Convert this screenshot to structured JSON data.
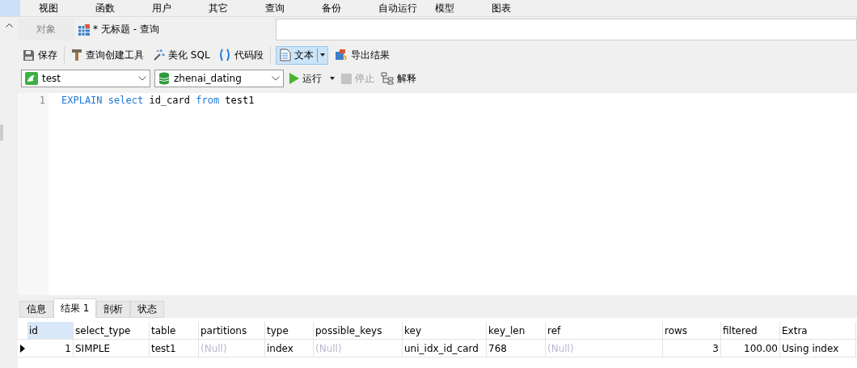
{
  "menu": [
    "视图",
    "函数",
    "用户",
    "其它",
    "查询",
    "备份",
    "自动运行",
    "模型",
    "图表"
  ],
  "tabs": [
    {
      "label": "对象",
      "selected": false
    },
    {
      "label": "* 无标题 - 查询",
      "selected": true
    }
  ],
  "toolbar": {
    "save": "保存",
    "builder": "查询创建工具",
    "beautify": "美化 SQL",
    "snippet": "代码段",
    "text": "文本",
    "export": "导出结果"
  },
  "connection": {
    "value": "test"
  },
  "database": {
    "value": "zhenai_dating"
  },
  "actions": {
    "run": "运行",
    "stop": "停止",
    "stop_disabled": true,
    "explain": "解释"
  },
  "editor": {
    "lines": [
      {
        "number": "1",
        "tokens": [
          {
            "text": "EXPLAIN",
            "kind": "keyword"
          },
          {
            "text": "select",
            "kind": "keyword"
          },
          {
            "text": "id_card",
            "kind": "plain"
          },
          {
            "text": "from",
            "kind": "keyword"
          },
          {
            "text": "test1",
            "kind": "plain"
          }
        ]
      }
    ]
  },
  "result_tabs": [
    {
      "label": "信息",
      "selected": false
    },
    {
      "label": "结果 1",
      "selected": true
    },
    {
      "label": "剖析",
      "selected": false
    },
    {
      "label": "状态",
      "selected": false
    }
  ],
  "table": {
    "columns": [
      {
        "label": "id",
        "numeric": true,
        "selected": true
      },
      {
        "label": "select_type",
        "numeric": false,
        "selected": false
      },
      {
        "label": "table",
        "numeric": false,
        "selected": false
      },
      {
        "label": "partitions",
        "numeric": false,
        "selected": false
      },
      {
        "label": "type",
        "numeric": false,
        "selected": false
      },
      {
        "label": "possible_keys",
        "numeric": false,
        "selected": false
      },
      {
        "label": "key",
        "numeric": false,
        "selected": false
      },
      {
        "label": "key_len",
        "numeric": false,
        "selected": false
      },
      {
        "label": "ref",
        "numeric": false,
        "selected": false
      },
      {
        "label": "rows",
        "numeric": true,
        "selected": false
      },
      {
        "label": "filtered",
        "numeric": true,
        "selected": false
      },
      {
        "label": "Extra",
        "numeric": false,
        "selected": false
      }
    ],
    "rows": [
      {
        "current": true,
        "cells": [
          {
            "text": "1",
            "null": false
          },
          {
            "text": "SIMPLE",
            "null": false
          },
          {
            "text": "test1",
            "null": false
          },
          {
            "text": "(Null)",
            "null": true
          },
          {
            "text": "index",
            "null": false
          },
          {
            "text": "(Null)",
            "null": true
          },
          {
            "text": "uni_idx_id_card",
            "null": false
          },
          {
            "text": "768",
            "null": false
          },
          {
            "text": "(Null)",
            "null": true
          },
          {
            "text": "3",
            "null": false
          },
          {
            "text": "100.00",
            "null": false
          },
          {
            "text": "Using index",
            "null": false
          }
        ]
      }
    ]
  }
}
